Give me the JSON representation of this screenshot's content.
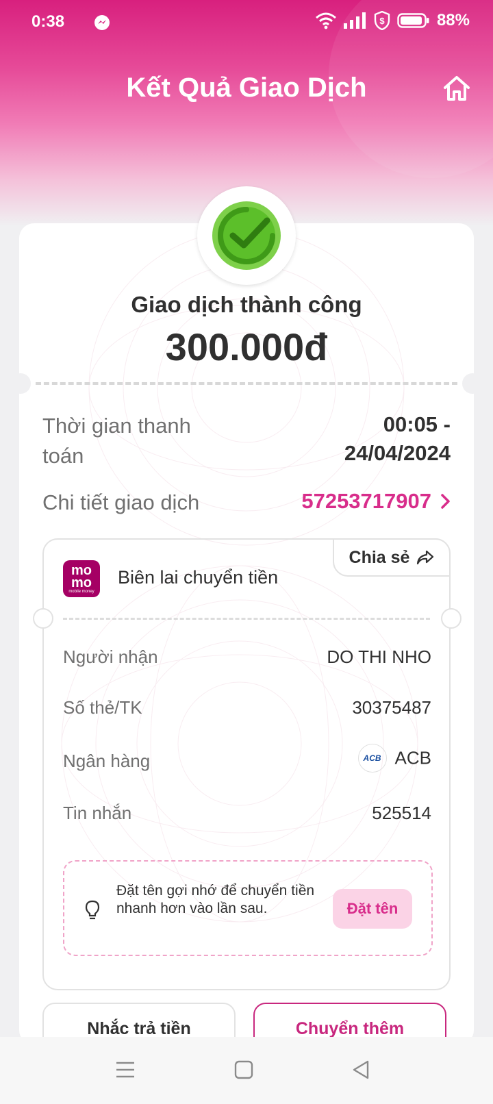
{
  "status_bar": {
    "time": "0:38",
    "battery": "88%"
  },
  "header": {
    "title": "Kết Quả Giao Dịch"
  },
  "result": {
    "status": "Giao dịch thành công",
    "amount": "300.000đ"
  },
  "info": {
    "time_label": "Thời gian thanh toán",
    "time_value_line1": "00:05 -",
    "time_value_line2": "24/04/2024",
    "detail_label": "Chi tiết giao dịch",
    "detail_value": "57253717907"
  },
  "receipt": {
    "share_label": "Chia sẻ",
    "logo_line1": "mo",
    "logo_line2": "mo",
    "logo_line3": "mobile money",
    "title": "Biên lai chuyển tiền",
    "rows": [
      {
        "label": "Người nhận",
        "value": "DO THI NHO"
      },
      {
        "label": "Số thẻ/TK",
        "value": "30375487"
      },
      {
        "label": "Ngân hàng",
        "value": "ACB"
      },
      {
        "label": "Tin nhắn",
        "value": "525514"
      }
    ],
    "bank_logo_text": "ACB",
    "tip_text": "Đặt tên gợi nhớ để chuyển tiền nhanh hơn vào lần sau.",
    "name_button": "Đặt tên"
  },
  "actions": {
    "remind_label": "Nhắc trả tiền",
    "transfer_more_label": "Chuyển thêm"
  },
  "colors": {
    "brand_pink": "#d82d8b",
    "success_green": "#5cbf2a",
    "momo_purple": "#a50064"
  },
  "icons": [
    "messenger-icon",
    "wifi-icon",
    "signal-icon",
    "shield-dollar-icon",
    "battery-icon",
    "home-icon",
    "check-circle-icon",
    "chevron-right-icon",
    "share-arrow-icon",
    "lightbulb-icon",
    "menu-icon",
    "square-icon",
    "back-triangle-icon"
  ]
}
